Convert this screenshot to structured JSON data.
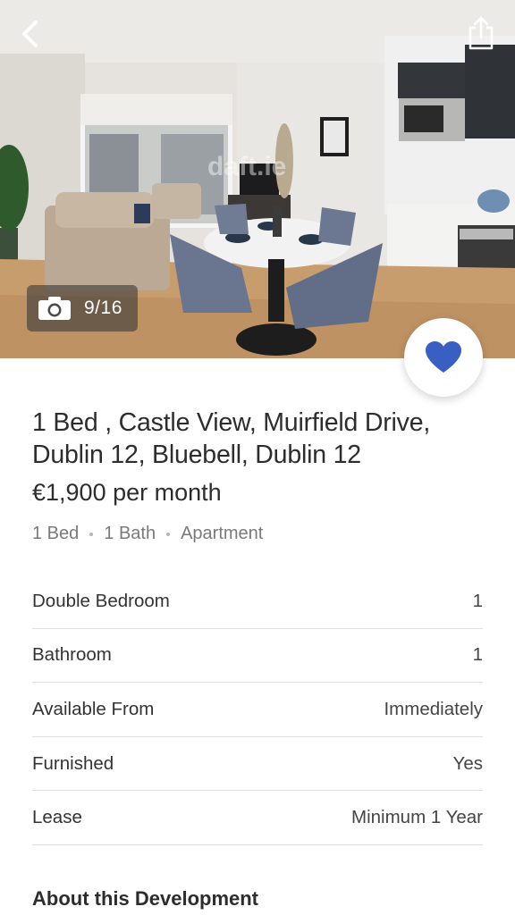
{
  "header": {
    "back_icon": "chevron-left-icon",
    "share_icon": "share-icon",
    "photo_counter": "9/16",
    "camera_icon": "camera-icon",
    "favourite_icon": "heart-icon",
    "watermark": "daft.ie"
  },
  "listing": {
    "title": "1 Bed , Castle View, Muirfield Drive, Dublin 12, Bluebell, Dublin 12",
    "price": "€1,900 per month",
    "beds": "1 Bed",
    "baths": "1 Bath",
    "type": "Apartment"
  },
  "facts": [
    {
      "label": "Double Bedroom",
      "value": "1"
    },
    {
      "label": "Bathroom",
      "value": "1"
    },
    {
      "label": "Available From",
      "value": "Immediately"
    },
    {
      "label": "Furnished",
      "value": "Yes"
    },
    {
      "label": "Lease",
      "value": "Minimum 1 Year"
    }
  ],
  "sections": {
    "about_heading": "About this Development"
  },
  "colors": {
    "accent_heart": "#3a5fc2",
    "text_primary": "#2d2d2d",
    "text_secondary": "#7a7a7a",
    "divider": "#dedede"
  }
}
